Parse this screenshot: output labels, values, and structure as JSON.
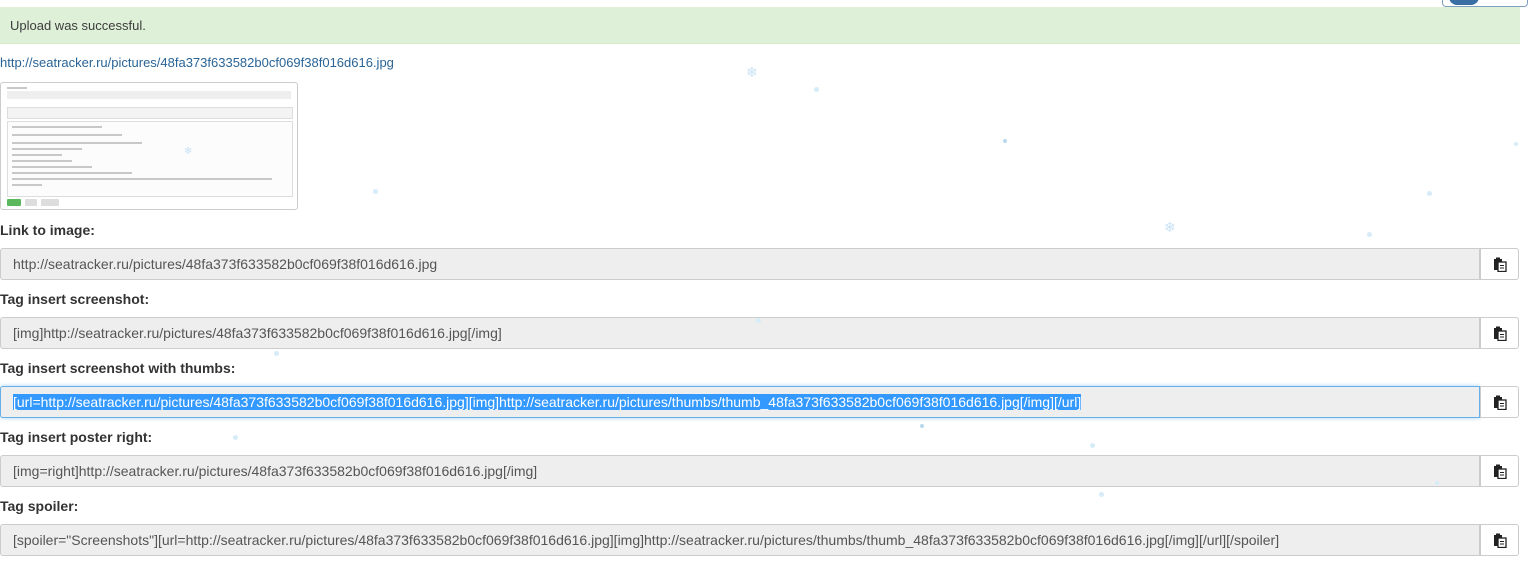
{
  "alert": {
    "message": "Upload was successful."
  },
  "top_link": "http://seatracker.ru/pictures/48fa373f633582b0cf069f38f016d616.jpg",
  "fields": [
    {
      "label": "Link to image:",
      "value": "http://seatracker.ru/pictures/48fa373f633582b0cf069f38f016d616.jpg",
      "selected": false
    },
    {
      "label": "Tag insert screenshot:",
      "value": "[img]http://seatracker.ru/pictures/48fa373f633582b0cf069f38f016d616.jpg[/img]",
      "selected": false
    },
    {
      "label": "Tag insert screenshot with thumbs:",
      "value": "[url=http://seatracker.ru/pictures/48fa373f633582b0cf069f38f016d616.jpg][img]http://seatracker.ru/pictures/thumbs/thumb_48fa373f633582b0cf069f38f016d616.jpg[/img][/url]",
      "selected": true
    },
    {
      "label": "Tag insert poster right:",
      "value": "[img=right]http://seatracker.ru/pictures/48fa373f633582b0cf069f38f016d616.jpg[/img]",
      "selected": false
    },
    {
      "label": "Tag spoiler:",
      "value": "[spoiler=\"Screenshots\"][url=http://seatracker.ru/pictures/48fa373f633582b0cf069f38f016d616.jpg][img]http://seatracker.ru/pictures/thumbs/thumb_48fa373f633582b0cf069f38f016d616.jpg[/img][/url][/spoiler]",
      "selected": false
    }
  ],
  "icons": {
    "copy": "clipboard-icon",
    "decor": "snowflake-icon"
  },
  "colors": {
    "alert_bg": "#dff0d8",
    "link": "#2a6496",
    "selection": "#3399ff",
    "field_bg": "#eeeeee"
  }
}
